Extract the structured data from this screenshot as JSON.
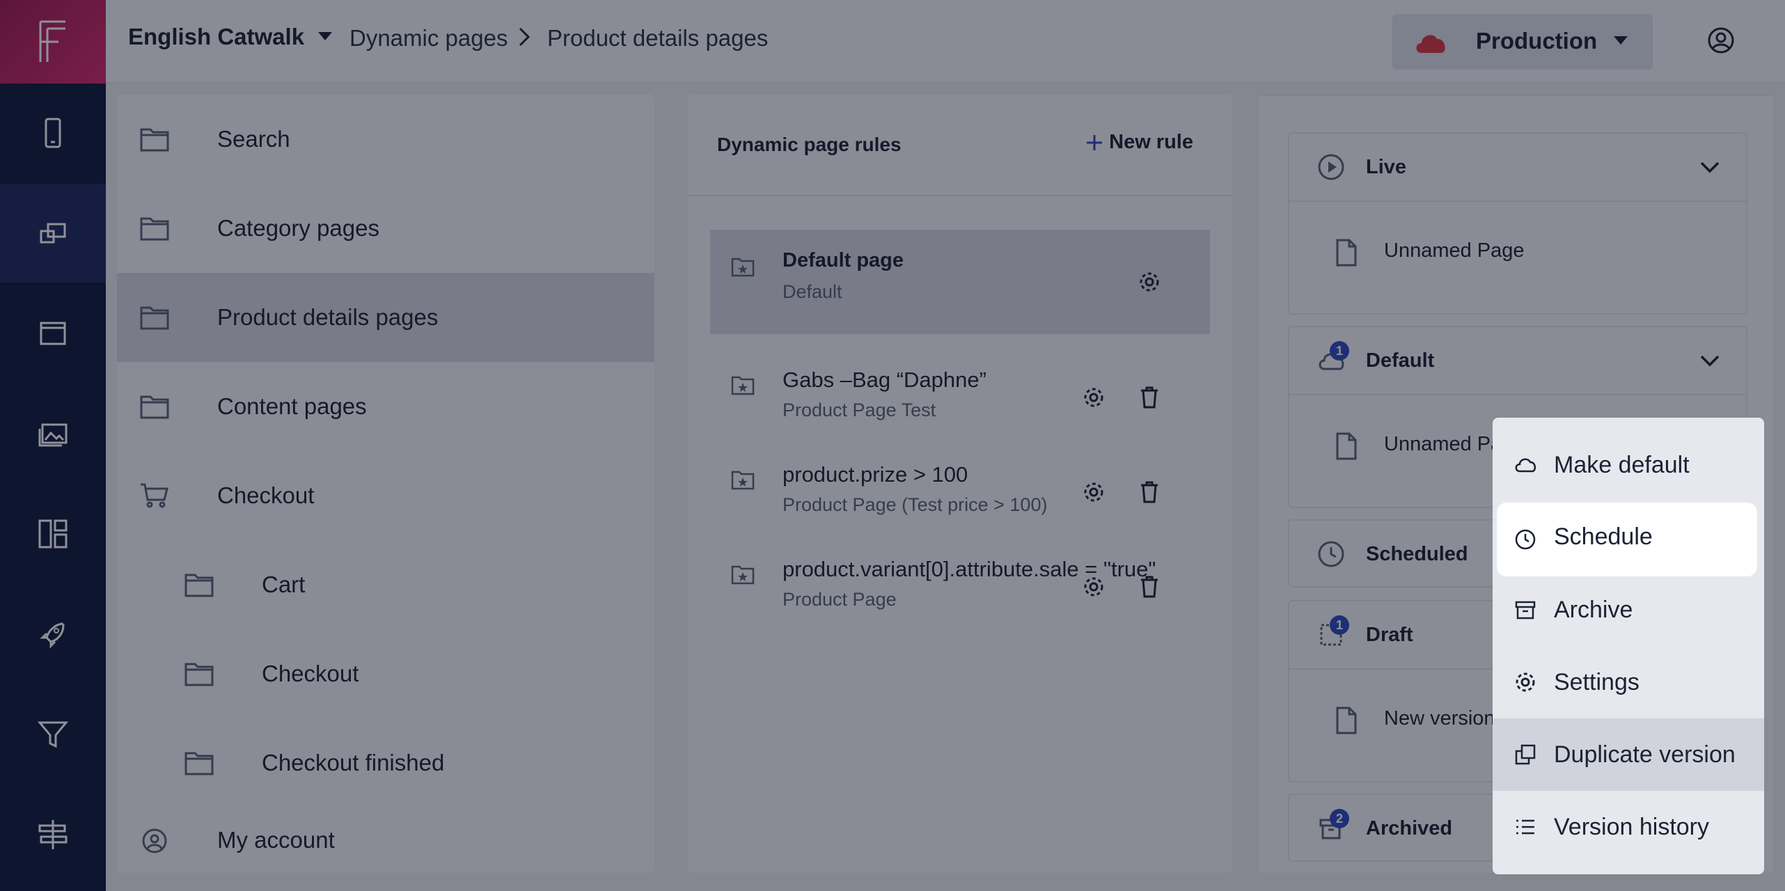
{
  "header": {
    "app_name": "English Catwalk",
    "breadcrumb": [
      "Dynamic pages",
      "Product details pages"
    ],
    "environment": "Production"
  },
  "nav": {
    "items": [
      {
        "label": "Search",
        "icon": "folder-icon"
      },
      {
        "label": "Category pages",
        "icon": "folder-icon"
      },
      {
        "label": "Product details pages",
        "icon": "folder-icon",
        "selected": true
      },
      {
        "label": "Content pages",
        "icon": "folder-icon"
      },
      {
        "label": "Checkout",
        "icon": "cart-icon"
      },
      {
        "label": "Cart",
        "icon": "folder-icon"
      },
      {
        "label": "Checkout",
        "icon": "folder-icon"
      },
      {
        "label": "Checkout finished",
        "icon": "folder-icon"
      },
      {
        "label": "My account",
        "icon": "user-circle-icon"
      }
    ]
  },
  "rules": {
    "title": "Dynamic page rules",
    "new_rule_label": "New rule",
    "items": [
      {
        "title": "Default page",
        "subtitle": "Default"
      },
      {
        "title": "Gabs –Bag “Daphne”",
        "subtitle": "Product Page Test"
      },
      {
        "title": "product.prize > 100",
        "subtitle": "Product Page (Test price > 100)"
      },
      {
        "title": "product.variant[0].attribute.sale = \"true\"",
        "subtitle": "Product Page"
      }
    ]
  },
  "versions": {
    "live": {
      "label": "Live",
      "page": "Unnamed Page"
    },
    "default": {
      "label": "Default",
      "badge": "1",
      "page": "Unnamed Pa"
    },
    "scheduled": {
      "label": "Scheduled"
    },
    "draft": {
      "label": "Draft",
      "badge": "1",
      "page": "New version"
    },
    "archived": {
      "label": "Archived",
      "badge": "2"
    }
  },
  "context_menu": {
    "items": [
      {
        "label": "Make default",
        "icon": "cloud-icon"
      },
      {
        "label": "Schedule",
        "icon": "clock-icon"
      },
      {
        "label": "Archive",
        "icon": "archive-icon"
      },
      {
        "label": "Settings",
        "icon": "gear-icon"
      },
      {
        "label": "Duplicate version",
        "icon": "duplicate-icon"
      },
      {
        "label": "Version history",
        "icon": "list-icon"
      }
    ]
  },
  "colors": {
    "rail": "#0e1a3d",
    "logo_gradient": "#d42a6e",
    "accent": "#2e4bbf",
    "environment_cloud": "#d9383f"
  }
}
